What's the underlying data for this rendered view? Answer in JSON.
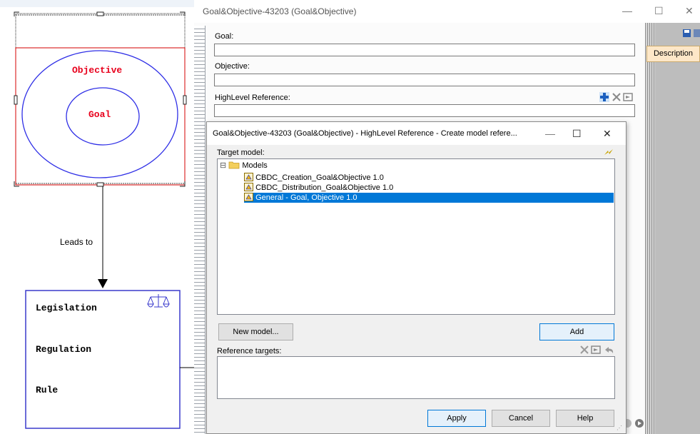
{
  "diagram": {
    "objective_label": "Objective",
    "goal_label": "Goal",
    "leads_to_label": "Leads to",
    "legislation_label": "Legislation",
    "regulation_label": "Regulation",
    "rule_label": "Rule",
    "colors": {
      "objective_text": "#e8001c",
      "ellipse_stroke": "#2e2ee6",
      "box_border": "#3a3acc",
      "selection_red": "#d40000"
    }
  },
  "main_window": {
    "title": "Goal&Objective-43203 (Goal&Objective)",
    "minimize_icon": "—",
    "maximize_icon": "☐",
    "close_icon": "✕",
    "fields": {
      "goal_label": "Goal:",
      "goal_value": "",
      "objective_label": "Objective:",
      "objective_value": "",
      "highlevel_label": "HighLevel Reference:",
      "highlevel_value": ""
    },
    "description_tab": "Description"
  },
  "dialog": {
    "title": "Goal&Objective-43203 (Goal&Objective) - HighLevel Reference - Create model refere...",
    "minimize_icon": "—",
    "maximize_icon": "☐",
    "close_icon": "✕",
    "target_model_label": "Target model:",
    "tree": {
      "root_expander": "⊟",
      "root_label": "Models",
      "items": [
        {
          "label": "CBDC_Creation_Goal&Objective  1.0",
          "selected": false
        },
        {
          "label": "CBDC_Distribution_Goal&Objective 1.0",
          "selected": false
        },
        {
          "label": "General - Goal, Objective 1.0",
          "selected": true
        }
      ]
    },
    "new_model_button": "New model...",
    "add_button": "Add",
    "reference_targets_label": "Reference targets:",
    "apply_button": "Apply",
    "cancel_button": "Cancel",
    "help_button": "Help",
    "selection_color": "#0078d7"
  }
}
